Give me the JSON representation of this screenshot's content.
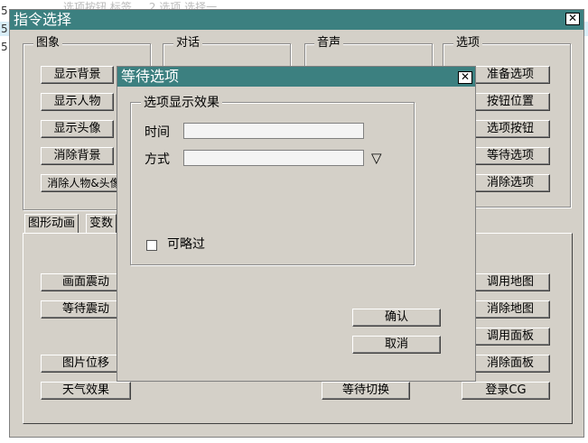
{
  "editor": {
    "lines": [
      {
        "num": "5",
        "text": "选项按钮  标签  ...  2  选项  选择一"
      },
      {
        "num": "5",
        "text": ""
      },
      {
        "num": "5",
        "text": ""
      }
    ]
  },
  "main_window": {
    "title": "指令选择",
    "close_icon": "✕",
    "groups": {
      "image": {
        "label": "图象",
        "buttons": [
          "显示背景",
          "显示人物",
          "显示头像",
          "消除背景",
          "消除人物&头像"
        ]
      },
      "dialog": {
        "label": "对话"
      },
      "sound": {
        "label": "音声"
      },
      "options": {
        "label": "选项",
        "buttons": [
          "准备选项",
          "按钮位置",
          "选项按钮",
          "等待选项",
          "消除选项"
        ]
      }
    },
    "tabs": [
      "图形动画",
      "变数"
    ],
    "tab_panel": {
      "left_buttons": [
        "画面震动",
        "等待震动",
        "图片位移",
        "天气效果"
      ],
      "center_buttons": [
        "等待切换"
      ],
      "right_buttons": [
        "调用地图",
        "消除地图",
        "调用面板",
        "消除面板",
        "登录CG"
      ]
    }
  },
  "dialog": {
    "title": "等待选项",
    "close_icon": "✕",
    "group_label": "选项显示效果",
    "time_label": "时间",
    "time_value": "",
    "mode_label": "方式",
    "mode_value": "",
    "dropdown_icon": "▽",
    "skip_label": "可略过",
    "skip_checked": false,
    "confirm_label": "确认",
    "cancel_label": "取消"
  }
}
